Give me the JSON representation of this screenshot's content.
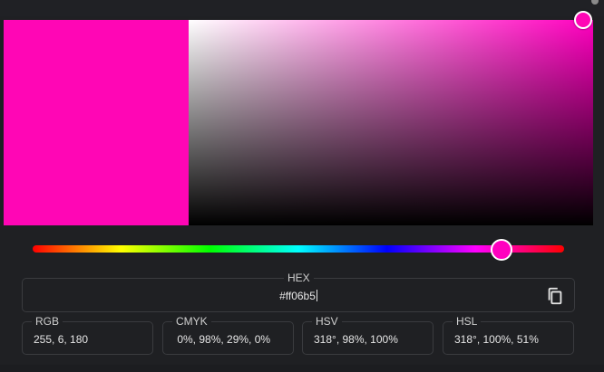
{
  "picker": {
    "current_color": "#ff06b5",
    "hue_color": "#ff00bf",
    "hue_fraction": 0.883,
    "saturation": 0.98,
    "value": 1.0
  },
  "hex": {
    "label": "HEX",
    "value": "#ff06b5"
  },
  "formats": {
    "rgb": {
      "label": "RGB",
      "value": "255, 6, 180"
    },
    "cmyk": {
      "label": "CMYK",
      "value": " 0%, 98%, 29%, 0%"
    },
    "hsv": {
      "label": "HSV",
      "value": "318°, 98%, 100%"
    },
    "hsl": {
      "label": "HSL",
      "value": "318°, 100%, 51%"
    }
  },
  "icons": {
    "copy": "copy-icon"
  }
}
